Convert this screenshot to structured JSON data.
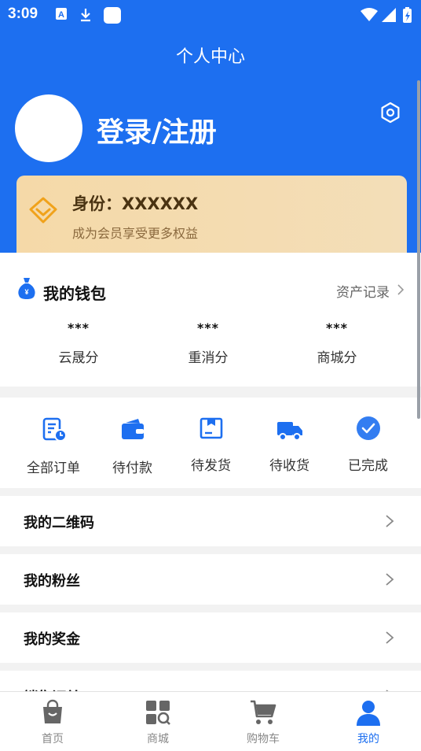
{
  "status_bar": {
    "time": "3:09"
  },
  "header": {
    "title": "个人中心",
    "login_label": "登录/注册"
  },
  "vip": {
    "title": "身份：XXXXXX",
    "subtitle": "成为会员享受更多权益"
  },
  "wallet": {
    "title": "我的钱包",
    "asset_link": "资产记录",
    "items": [
      {
        "value": "***",
        "label": "云晟分"
      },
      {
        "value": "***",
        "label": "重消分"
      },
      {
        "value": "***",
        "label": "商城分"
      }
    ]
  },
  "orders": {
    "items": [
      {
        "label": "全部订单",
        "icon": "order-list-icon"
      },
      {
        "label": "待付款",
        "icon": "wallet-pay-icon"
      },
      {
        "label": "待发货",
        "icon": "package-icon"
      },
      {
        "label": "待收货",
        "icon": "truck-icon"
      },
      {
        "label": "已完成",
        "icon": "check-circle-icon"
      }
    ]
  },
  "menu": {
    "items": [
      {
        "label": "我的二维码"
      },
      {
        "label": "我的粉丝"
      },
      {
        "label": "我的奖金"
      },
      {
        "label": "销售订单"
      }
    ]
  },
  "tabbar": {
    "items": [
      {
        "label": "首页",
        "icon": "shopping-bag-icon"
      },
      {
        "label": "商城",
        "icon": "grid-search-icon"
      },
      {
        "label": "购物车",
        "icon": "cart-icon"
      },
      {
        "label": "我的",
        "icon": "person-icon"
      }
    ],
    "active": "我的"
  },
  "colors": {
    "brand_blue": "#1d6ff0",
    "vip_gold": "#f5d9a8",
    "vip_accent": "#f0a21b"
  }
}
